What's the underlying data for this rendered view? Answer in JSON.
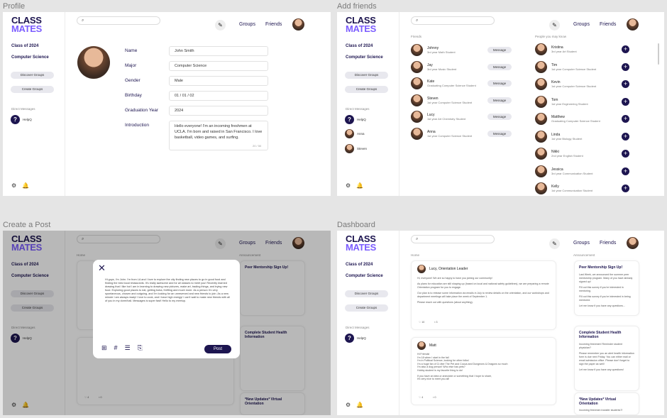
{
  "frames": {
    "profile": "Profile",
    "add_friends": "Add friends",
    "create_post": "Create a Post",
    "dashboard": "Dashboard"
  },
  "logo": {
    "line1": "CLASS",
    "line2": "MATES"
  },
  "sidebar": {
    "class_year": "Class of 2024",
    "major": "Computer Science",
    "discover": "Discover Groups",
    "create": "Create Groups",
    "dm_title": "Direct Messages",
    "dm_user": "HelpQ",
    "dm_anna": "Anna",
    "dm_steven": "Steven"
  },
  "header": {
    "groups": "Groups",
    "friends": "Friends",
    "search_icon": "search-icon",
    "edit_icon": "pencil-icon"
  },
  "profile": {
    "labels": [
      "Name",
      "Major",
      "Gender",
      "Birthday",
      "Graduation Year",
      "Introduction"
    ],
    "values": [
      "John Smith",
      "Computer Science",
      "Male",
      "01 / 01 / 02",
      "2024",
      "Hello everyone! I'm an incoming freshmen at UCLA. I'm born and raised in San Francisco. I love basketball, video games, and surfing."
    ],
    "counter": "20 / 50"
  },
  "friends": {
    "title": "Friends",
    "message": "Message",
    "list": [
      {
        "name": "Johnny",
        "desc": "3rd year Math Student"
      },
      {
        "name": "Jay",
        "desc": "3rd year Music Student"
      },
      {
        "name": "Kate",
        "desc": "Graduating Computer Science Student"
      },
      {
        "name": "Steven",
        "desc": "1st year Computer Science Student"
      },
      {
        "name": "Lucy",
        "desc": "1st year Art Chemistry Student"
      },
      {
        "name": "Anna",
        "desc": "1st year Computer Science Student"
      }
    ]
  },
  "suggest": {
    "title": "People you may know",
    "list": [
      {
        "name": "Kristina",
        "desc": "3rd year Art Student"
      },
      {
        "name": "Tim",
        "desc": "1st year Computer Science Student"
      },
      {
        "name": "Kevin",
        "desc": "1st year Computer Science Student"
      },
      {
        "name": "Tom",
        "desc": "1st year Engineering Student"
      },
      {
        "name": "Matthew",
        "desc": "Graduating Computer Science Student"
      },
      {
        "name": "Linda",
        "desc": "1st year Biology Student"
      },
      {
        "name": "Nikki",
        "desc": "2nd year English Student"
      },
      {
        "name": "Jessica",
        "desc": "3rd year Communication Student"
      },
      {
        "name": "Kelly",
        "desc": "1st year Communication Student"
      }
    ]
  },
  "feed": {
    "home": "Home",
    "announcement": "Announcement",
    "post1": {
      "author": "Lucy, Orientation Leader",
      "likes": "10",
      "comments": "3",
      "text": "Hi, everyone! We are so happy to have you joining our community!",
      "text2": "As plans for education are still shaping up (based on local and national safety guidelines), we are preparing a remote Orientation program for you to engage.",
      "text3": "Our plan is to release some information via emails in July to review details on the orientation, and our workshops and department meetings will take place the week of September 1.",
      "text4": "Please reach out with questions (about anything)."
    },
    "post2": {
      "author": "Matt",
      "likes": "4",
      "comments": "0",
      "lines": [
        "Hi Friends!",
        "I'm 18 when I start in the fall",
        "I'm in Political Science, looking for other folks!",
        "I'm a huge fan of Cr-itter The Pet and Cocoa and Dungeons & Dragons so much",
        "I'm also a dog person! Who else has pets?",
        "Hobby student is my favorite thing to do!",
        "If you have an idea or anecdote or something that I hope to share,",
        "It's very nice to meet you all!"
      ]
    }
  },
  "ann": {
    "a1": {
      "title": "Peer Mentorship Sign Up!",
      "body": "Last Week, we announced the summer peer mentorship program. Many of you have already signed up!",
      "body2": "Fill out this survey if you're interested in mentoring.",
      "body3": "Fill out this survey if you're interested in being mentored.",
      "body4": "Let me know if you have any questions..."
    },
    "a2": {
      "title": "Complete Student Health Information",
      "body": "Incoming freshmen! Reminder student physician?",
      "body2": "Please remember you an alert health information form is due next Friday. You can either mail or email admission office. Please don't forget to sign the paper as well!",
      "body3": "Let me know if you have any questions!"
    },
    "a3": {
      "title": "*New Updates* Virtual Orientation",
      "body": "Incoming freshmen transfer students?!"
    }
  },
  "post_modal": {
    "text": "Hi guys, I'm John. I'm from LA and I love to explore the city finding new places to go in good food and finding the best local restaurants. It's really awesome and for all classes to meet you! Recently learned drawing that I like but I am in learning to drawing new pictures, make art, trading things, and trying new food. Exploring good places to eat, getting boba, thrifting and much more. As a person I'm very spontaneous, chosen and outgoing, and I'm looking for an unreserved and new friends to join. As a new minute I am always ready! I love to cook, and I have high energy! I can't wait to make new friends with all of you in my dorm/hall. Messages is super fast! Hello to my meetup.",
    "post": "Post"
  }
}
